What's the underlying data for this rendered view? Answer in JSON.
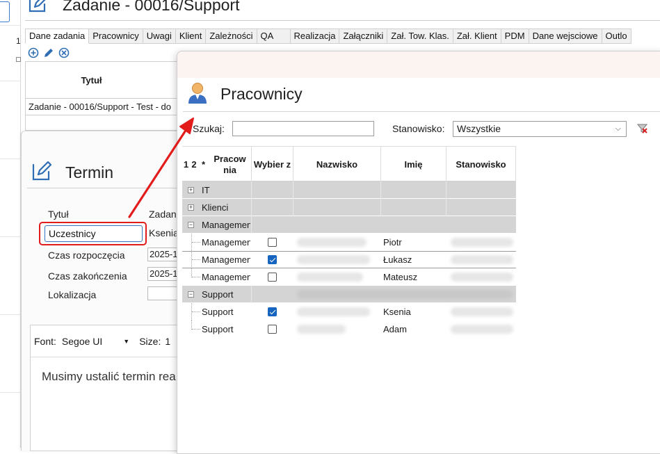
{
  "app": {
    "title": "Zadanie - 00016/Support",
    "left_number": "1",
    "tabs": [
      "Dane zadania",
      "Pracownicy",
      "Uwagi",
      "Klient",
      "Zależności",
      "QA",
      "Realizacja",
      "Załączniki",
      "Zał. Tow. Klas.",
      "Zał. Klient",
      "PDM",
      "Dane wejsciowe",
      "Outlo"
    ],
    "grid_header": "Tytuł",
    "grid_row": "Zadanie - 00016/Support - Test - do"
  },
  "termin": {
    "title": "Termin",
    "fields": {
      "tytul_label": "Tytuł",
      "tytul_value": "Zadan",
      "uczestnicy_label": "Uczestnicy",
      "uczestnicy_value": "Ksenia",
      "start_label": "Czas rozpoczęcia",
      "start_value": "2025-1",
      "end_label": "Czas zakończenia",
      "end_value": "2025-1",
      "location_label": "Lokalizacja"
    },
    "editor": {
      "font_label": "Font:",
      "font_value": "Segoe UI",
      "size_label": "Size:",
      "size_value": "1",
      "body": "Musimy ustalić termin rea"
    }
  },
  "dialog": {
    "title": "Pracownicy",
    "search_label": "Szukaj:",
    "search_value": "",
    "position_label": "Stanowisko:",
    "position_value": "Wszystkie",
    "columns": {
      "c1": "1",
      "c2": "2",
      "c3": "*",
      "pracownia": "Pracow nia",
      "wybierz": "Wybier z",
      "nazwisko": "Nazwisko",
      "imie": "Imię",
      "stanowisko": "Stanowisko"
    },
    "groups": [
      {
        "name": "IT",
        "expanded": false
      },
      {
        "name": "Klienci",
        "expanded": false
      },
      {
        "name": "Management",
        "expanded": true
      },
      {
        "name": "Support",
        "expanded": true
      }
    ],
    "rows": [
      {
        "group": "Management",
        "pracownia": "Management",
        "selected": false,
        "imie": "Piotr"
      },
      {
        "group": "Management",
        "pracownia": "Management",
        "selected": true,
        "imie": "Łukasz"
      },
      {
        "group": "Management",
        "pracownia": "Management",
        "selected": false,
        "imie": "Mateusz"
      },
      {
        "group": "Support",
        "pracownia": "Support",
        "selected": true,
        "imie": "Ksenia"
      },
      {
        "group": "Support",
        "pracownia": "Support",
        "selected": false,
        "imie": "Adam"
      }
    ]
  },
  "colors": {
    "accent_blue": "#1565c0",
    "highlight_red": "#e21b1b",
    "group_row": "#d4d4d4",
    "dialog_top": "#fbf4f1"
  },
  "icons": [
    "add-icon",
    "edit-icon",
    "delete-icon",
    "edit-note-icon",
    "user-icon",
    "clear-filter-icon"
  ]
}
